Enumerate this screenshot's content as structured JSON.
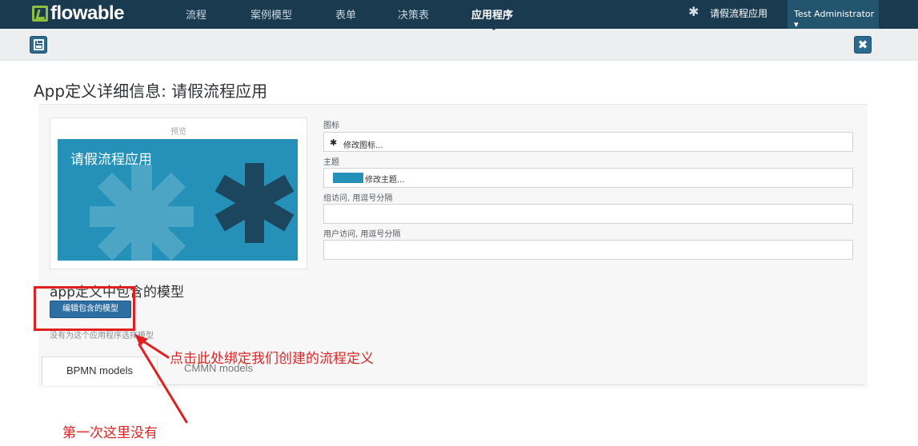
{
  "brand": {
    "name": "flowable"
  },
  "nav": {
    "items": [
      {
        "label": "流程",
        "active": false
      },
      {
        "label": "案例模型",
        "active": false
      },
      {
        "label": "表单",
        "active": false
      },
      {
        "label": "决策表",
        "active": false
      },
      {
        "label": "应用程序",
        "active": true
      }
    ],
    "current_app": "请假流程应用",
    "user": "Test Administrator ▾"
  },
  "toolbar": {
    "save_icon": "floppy-disk-icon",
    "close_icon": "close-icon",
    "close_glyph": "✖"
  },
  "page": {
    "title": "App定义详细信息: 请假流程应用"
  },
  "preview": {
    "label": "预览",
    "tile_name": "请假流程应用",
    "tile_color": "#2591b8"
  },
  "form": {
    "icon_label": "图标",
    "icon_value": "修改图标...",
    "icon_glyph": "✱",
    "theme_label": "主题",
    "theme_value": "修改主题...",
    "group_label": "组访问, 用逗号分隔",
    "group_value": "",
    "user_label": "用户访问, 用逗号分隔",
    "user_value": ""
  },
  "models": {
    "section_title": "app定义中包含的模型",
    "edit_button": "编辑包含的模型",
    "empty_text": "没有为这个应用程序选择模型",
    "tabs": [
      {
        "label": "BPMN models",
        "active": true
      },
      {
        "label": "CMMN models",
        "active": false
      }
    ]
  },
  "annotations": {
    "click_here": "点击此处绑定我们创建的流程定义",
    "first_time": "第一次这里没有",
    "color": "#e02020"
  }
}
